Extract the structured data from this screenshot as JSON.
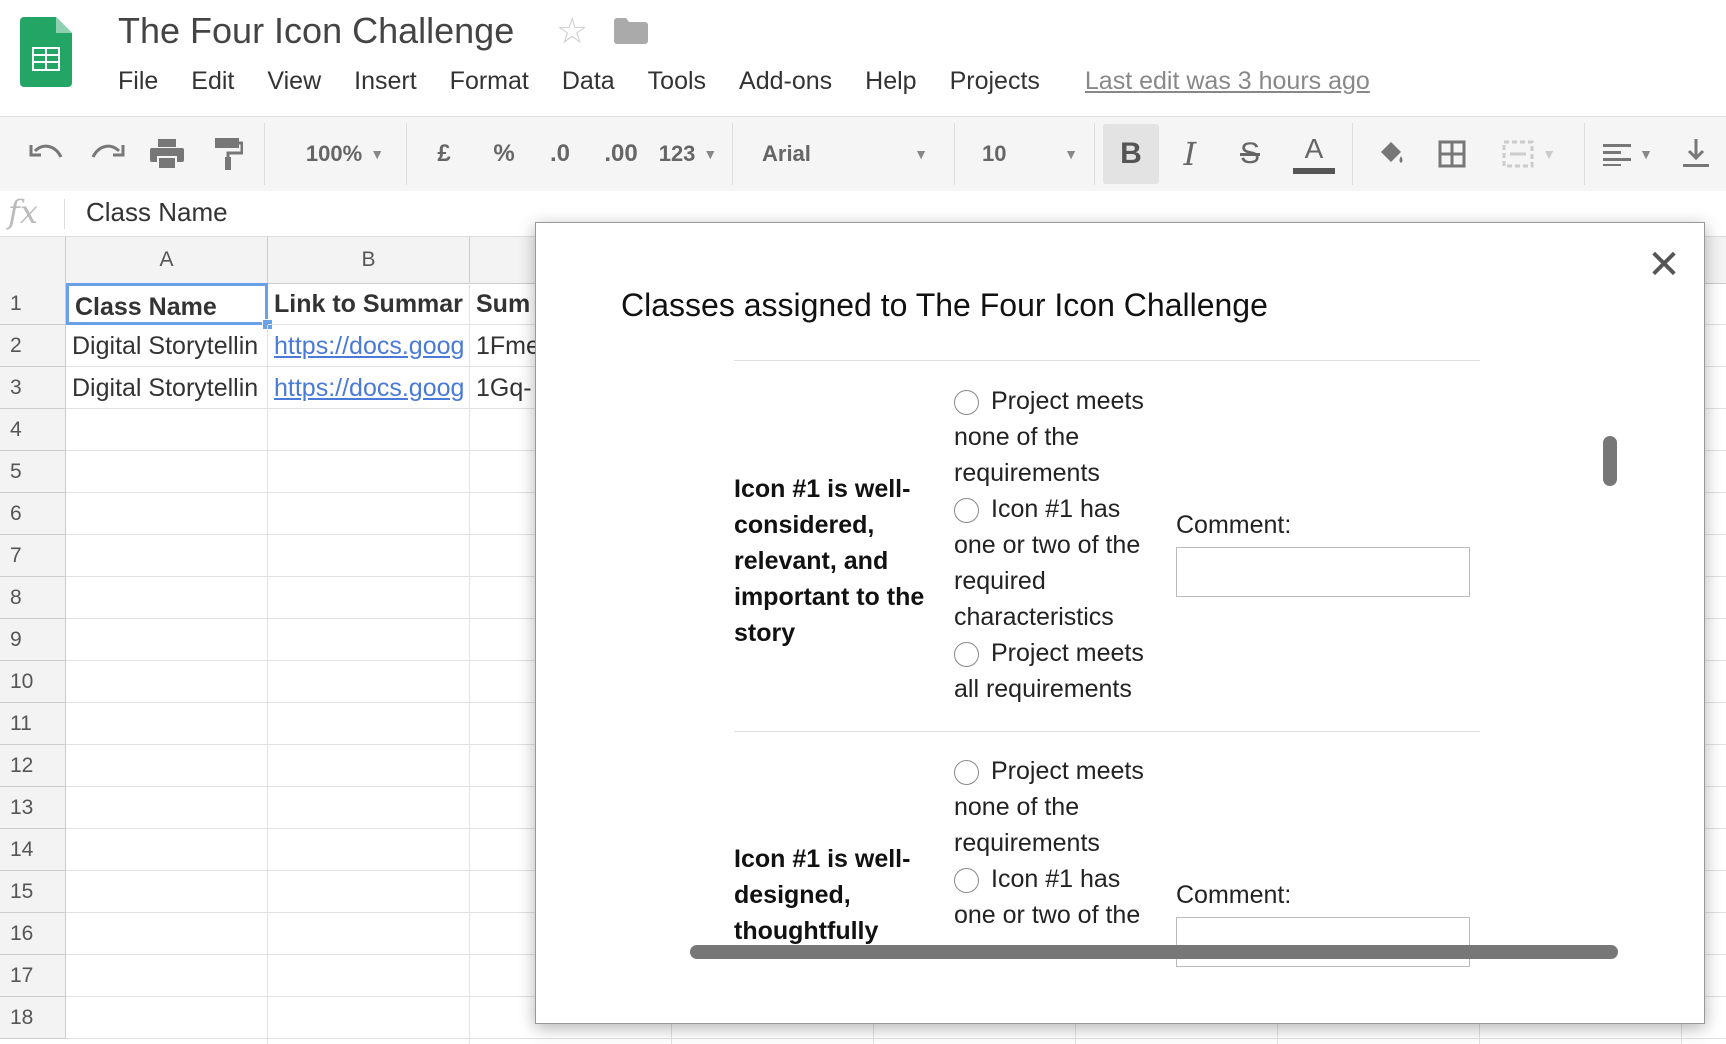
{
  "app": {
    "title": "The Four Icon Challenge",
    "menu": [
      "File",
      "Edit",
      "View",
      "Insert",
      "Format",
      "Data",
      "Tools",
      "Add-ons",
      "Help",
      "Projects"
    ],
    "last_edit": "Last edit was 3 hours ago"
  },
  "toolbar": {
    "zoom": "100%",
    "currency": "£",
    "percent": "%",
    "decrease_decimal": ".0",
    "increase_decimal": ".00",
    "number_format": "123",
    "font": "Arial",
    "font_size": "10",
    "bold": "B",
    "italic": "I",
    "strikethrough": "S",
    "text_color": "A"
  },
  "formula_bar": {
    "fx": "fx",
    "value": "Class Name"
  },
  "sheet": {
    "columns": [
      "A",
      "B"
    ],
    "rows": [
      "1",
      "2",
      "3",
      "4",
      "5",
      "6",
      "7",
      "8",
      "9",
      "10",
      "11",
      "12",
      "13",
      "14",
      "15",
      "16",
      "17",
      "18"
    ],
    "cells": [
      [
        "Class Name",
        "Link to Summar",
        "Sum"
      ],
      [
        "Digital Storytellin",
        "https://docs.goog",
        "1Fme"
      ],
      [
        "Digital Storytellin",
        "https://docs.goog",
        "1Gq-"
      ]
    ]
  },
  "dialog": {
    "title": "Classes assigned to The Four Icon Challenge",
    "criteria": [
      {
        "label": "Icon #1 is well-considered, relevant, and important to the story",
        "options": [
          "Project meets none of the requirements",
          "Icon #1 has one or two of the required characteristics",
          "Project meets all requirements"
        ],
        "comment_label": "Comment:"
      },
      {
        "label": "Icon #1 is well-designed, thoughtfully",
        "options": [
          "Project meets none of the requirements",
          "Icon #1 has one or two of the"
        ],
        "comment_label": "Comment:"
      }
    ]
  }
}
